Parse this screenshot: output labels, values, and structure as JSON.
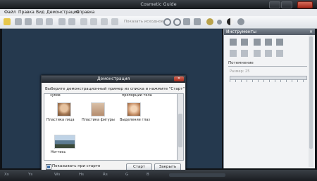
{
  "window": {
    "title": "Cosmetic Guide"
  },
  "menu": {
    "items": [
      "Файл",
      "Правка",
      "Вид",
      "Демонстрация",
      "Справка"
    ]
  },
  "toolbar": {
    "show_original": "Показать исходное"
  },
  "panel": {
    "title": "Инструменты",
    "close": "×",
    "section": "Потемнение",
    "field_label": "Размер: 25"
  },
  "dialog": {
    "title": "Демонстрация",
    "close": "✕",
    "instruction": "Выберите демонстрационный пример из списка и нажмите \"Старт\"",
    "row_top_labels": [
      "зубов",
      "пропорции тела"
    ],
    "items": [
      "Пластика лица",
      "Пластика фигуры",
      "Выделение глаз",
      "Ногтись"
    ],
    "show_on_start": "Показывать при старте",
    "start": "Старт",
    "close_button": "Закрыть"
  },
  "status": {
    "labels": [
      "Xs",
      "Ys",
      "Ws",
      "Hs",
      "Rs",
      "G",
      "B"
    ]
  },
  "colors": {
    "canvas": "#25394e",
    "titlebar": "#1f242a",
    "accent": "#4a7fc1"
  }
}
